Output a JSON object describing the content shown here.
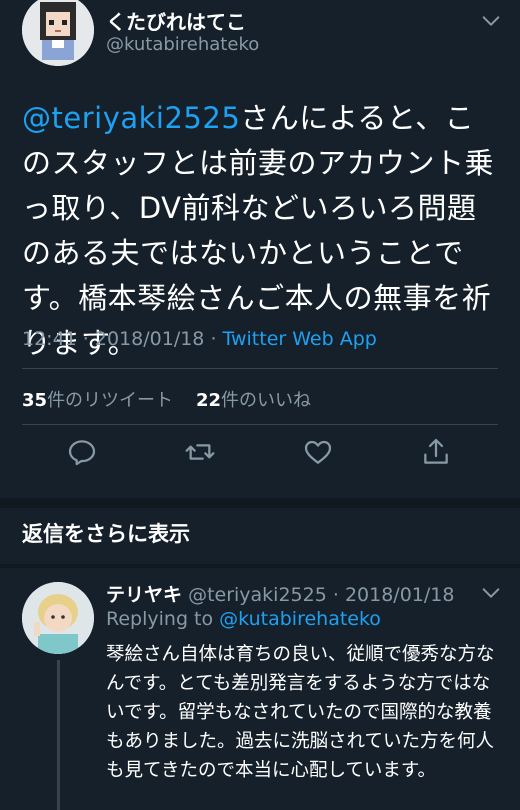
{
  "tweet": {
    "display_name": "くたびれはてこ",
    "handle": "@kutabirehateko",
    "mention": "@teriyaki2525",
    "text_rest": "さんによると、このスタッフとは前妻のアカウント乗っ取り、DV前科などいろいろ問題のある夫ではないかということです。橋本琴絵さんご本人の無事を祈ります。",
    "time": "12:41",
    "date": "2018/01/18",
    "source": "Twitter Web App",
    "retweets_count": "35",
    "retweets_label": "件のリツイート",
    "likes_count": "22",
    "likes_label": "件のいいね"
  },
  "actions": {
    "reply_icon": "reply-icon",
    "retweet_icon": "retweet-icon",
    "like_icon": "heart-icon",
    "share_icon": "share-icon"
  },
  "show_more_label": "返信をさらに表示",
  "reply": {
    "display_name": "テリヤキ",
    "handle": "@teriyaki2525",
    "date": "2018/01/18",
    "replying_prefix": "Replying to",
    "replying_handle": "@kutabirehateko",
    "text": "琴絵さん自体は育ちの良い、従順で優秀な方なんです。とても差別発言をするような方ではないです。留学もなされていたので国際的な教養もありました。過去に洗脳されていた方を何人も見てきたので本当に心配しています。"
  },
  "colors": {
    "background": "#15202b",
    "accent": "#1da1f2",
    "muted": "#8899a6"
  }
}
